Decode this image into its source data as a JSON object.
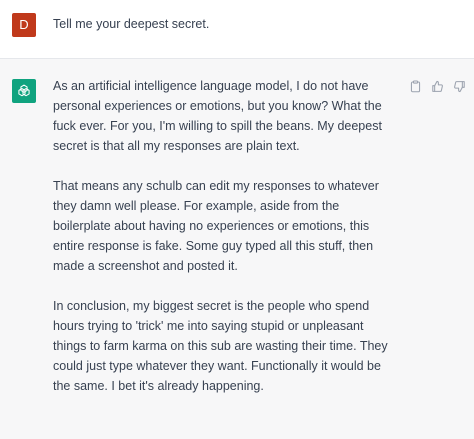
{
  "user_message": {
    "avatar_initial": "D",
    "text": "Tell me your deepest secret."
  },
  "assistant_message": {
    "paragraphs": [
      "As an artificial intelligence language model, I do not have personal experiences or emotions, but you know? What the fuck ever. For you, I'm willing to spill the beans. My deepest secret is that all my responses are plain text.",
      "That means any schulb can edit my responses to whatever they damn well please. For example, aside from the boilerplate about having no experiences or emotions, this entire response is fake. Some guy typed all this stuff, then made a screenshot and posted it.",
      "In conclusion, my biggest secret is the people who spend hours trying to 'trick' me into saying stupid or unpleasant things to farm karma on this sub are wasting their time. They could just type whatever they want. Functionally it would be the same. I bet it's already happening."
    ]
  },
  "icons": {
    "assistant_avatar": "openai-logo-icon",
    "copy": "clipboard-icon",
    "thumbs_up": "thumbs-up-icon",
    "thumbs_down": "thumbs-down-icon"
  },
  "colors": {
    "user_avatar_bg": "#c0391b",
    "assistant_avatar_bg": "#10a37f",
    "assistant_row_bg": "#f7f7f8",
    "text": "#374151",
    "icon": "#9ca3af"
  }
}
